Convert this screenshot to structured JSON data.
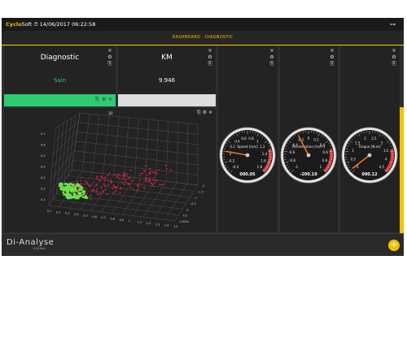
{
  "topbar": {
    "brand_a": "Cyclo",
    "brand_b": "Soft",
    "datetime": "⏱ 14/06/2017 06:22:58",
    "key_icon": "key-icon"
  },
  "breadcrumb": "DASHBOARD : DIAGNOSTIC",
  "widgets": {
    "diagnostic": {
      "title": "Diagnostic",
      "value": "Sain",
      "value_color": "#2ecc71",
      "bar_color": "#2ecc71"
    },
    "km": {
      "title": "KM",
      "value": "9.946",
      "bar_color": "#dcdcdc"
    }
  },
  "controls": {
    "close": "✕",
    "settings": "⚙",
    "copy": "⎘"
  },
  "scatter": {
    "label": "3D",
    "yticks": [
      "0.7",
      "0.6",
      "0.5",
      "0.4",
      "0.3",
      "0.2",
      "0.1"
    ],
    "xticks": [
      "0.1",
      "0.2",
      "0.3",
      "0.4",
      "0.5",
      "0.6",
      "0.7",
      "0.8",
      "0.9",
      "1",
      "1.1",
      "1.2",
      "1.3",
      "1.4",
      "1.5"
    ],
    "zticks": [
      "1 000k",
      "0.5",
      "0",
      "-0.5",
      "-1",
      "-1.5",
      "-2"
    ],
    "colors": {
      "green": "#6ee04a",
      "red": "#e8204a"
    }
  },
  "gauges": [
    {
      "name": "speed",
      "label": "Speed [m/s]",
      "readout": "000.05",
      "ticks": [
        "-0.4",
        "-0.2",
        "0",
        "0.2",
        "0.4",
        "0.6",
        "0.8",
        "1",
        "1.2",
        "1.4",
        "1.6",
        "1.8"
      ]
    },
    {
      "name": "acceleration",
      "label": "Acceleration [m/s²]",
      "readout": "-200.19",
      "ticks": [
        "-1",
        "-0.8",
        "-0.6",
        "-0.4",
        "-0.2",
        "0",
        "0.2",
        "0.4",
        "0.6",
        "0.8",
        "1"
      ]
    },
    {
      "name": "torque",
      "label": "Torque [N.m]",
      "readout": "000.12",
      "ticks": [
        "0",
        "0.5",
        "1",
        "1.5",
        "2",
        "2.5",
        "3",
        "3.5",
        "4",
        "4.5"
      ]
    }
  ],
  "gauge_values": {
    "speed": 0.05,
    "acceleration": -0.2019,
    "torque": 0.12
  },
  "footer": {
    "logo": "Di-Analyse",
    "logo_sub": "SIGNAL",
    "fab": "+"
  }
}
